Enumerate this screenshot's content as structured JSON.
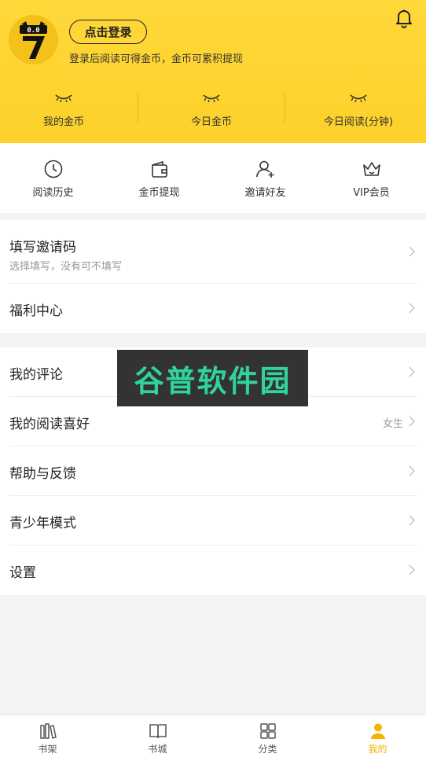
{
  "header": {
    "login_label": "点击登录",
    "login_hint": "登录后阅读可得金币，金币可累积提现",
    "stats": [
      {
        "label": "我的金币"
      },
      {
        "label": "今日金币"
      },
      {
        "label": "今日阅读(分钟)"
      }
    ]
  },
  "quick": [
    {
      "label": "阅读历史",
      "icon": "clock-icon"
    },
    {
      "label": "金币提现",
      "icon": "wallet-icon"
    },
    {
      "label": "邀请好友",
      "icon": "add-user-icon"
    },
    {
      "label": "VIP会员",
      "icon": "crown-icon"
    }
  ],
  "group1": {
    "invite": {
      "title": "填写邀请码",
      "sub": "选择填写，没有可不填写"
    },
    "welfare": {
      "title": "福利中心"
    }
  },
  "group2": {
    "comments": {
      "title": "我的评论"
    },
    "preference": {
      "title": "我的阅读喜好",
      "value": "女生"
    },
    "help": {
      "title": "帮助与反馈"
    },
    "youth": {
      "title": "青少年模式"
    },
    "settings": {
      "title": "设置"
    }
  },
  "watermark": "谷普软件园",
  "tabbar": [
    {
      "label": "书架",
      "icon": "bookshelf-icon"
    },
    {
      "label": "书城",
      "icon": "book-icon"
    },
    {
      "label": "分类",
      "icon": "grid-icon"
    },
    {
      "label": "我的",
      "icon": "user-icon",
      "active": true
    }
  ],
  "colors": {
    "accent": "#fdd12a",
    "active_tab": "#f5b400"
  }
}
